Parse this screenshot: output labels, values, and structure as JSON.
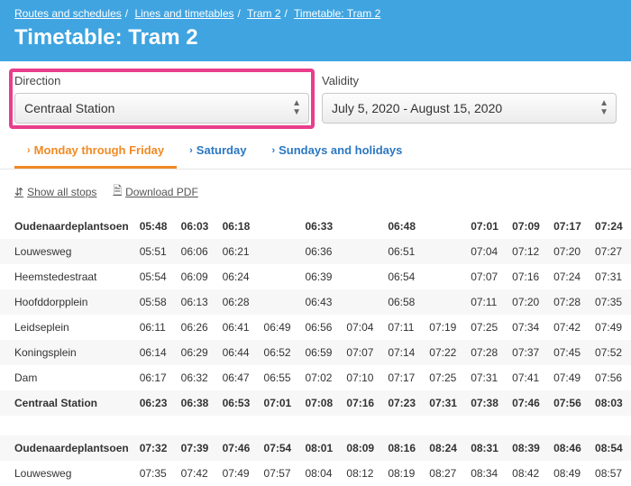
{
  "breadcrumb": [
    "Routes and schedules",
    "Lines and timetables",
    "Tram 2",
    "Timetable: Tram 2"
  ],
  "page_title": "Timetable: Tram 2",
  "selectors": {
    "direction_label": "Direction",
    "direction_value": "Centraal Station",
    "validity_label": "Validity",
    "validity_value": "July 5, 2020 - August 15, 2020"
  },
  "tabs": [
    "Monday through Friday",
    "Saturday",
    "Sundays and holidays"
  ],
  "actions": {
    "show_all_stops": "Show all stops",
    "download_pdf": "Download PDF"
  },
  "stops": [
    "Oudenaardeplantsoen",
    "Louwesweg",
    "Heemstedestraat",
    "Hoofddorpplein",
    "Leidseplein",
    "Koningsplein",
    "Dam",
    "Centraal Station"
  ],
  "block1": [
    [
      "05:48",
      "06:03",
      "06:18",
      "",
      "06:33",
      "",
      "06:48",
      "",
      "07:01",
      "07:09",
      "07:17",
      "07:24"
    ],
    [
      "05:51",
      "06:06",
      "06:21",
      "",
      "06:36",
      "",
      "06:51",
      "",
      "07:04",
      "07:12",
      "07:20",
      "07:27"
    ],
    [
      "05:54",
      "06:09",
      "06:24",
      "",
      "06:39",
      "",
      "06:54",
      "",
      "07:07",
      "07:16",
      "07:24",
      "07:31"
    ],
    [
      "05:58",
      "06:13",
      "06:28",
      "",
      "06:43",
      "",
      "06:58",
      "",
      "07:11",
      "07:20",
      "07:28",
      "07:35"
    ],
    [
      "06:11",
      "06:26",
      "06:41",
      "06:49",
      "06:56",
      "07:04",
      "07:11",
      "07:19",
      "07:25",
      "07:34",
      "07:42",
      "07:49"
    ],
    [
      "06:14",
      "06:29",
      "06:44",
      "06:52",
      "06:59",
      "07:07",
      "07:14",
      "07:22",
      "07:28",
      "07:37",
      "07:45",
      "07:52"
    ],
    [
      "06:17",
      "06:32",
      "06:47",
      "06:55",
      "07:02",
      "07:10",
      "07:17",
      "07:25",
      "07:31",
      "07:41",
      "07:49",
      "07:56"
    ],
    [
      "06:23",
      "06:38",
      "06:53",
      "07:01",
      "07:08",
      "07:16",
      "07:23",
      "07:31",
      "07:38",
      "07:46",
      "07:56",
      "08:03"
    ]
  ],
  "block2": [
    [
      "07:32",
      "07:39",
      "07:46",
      "07:54",
      "08:01",
      "08:09",
      "08:16",
      "08:24",
      "08:31",
      "08:39",
      "08:46",
      "08:54"
    ],
    [
      "07:35",
      "07:42",
      "07:49",
      "07:57",
      "08:04",
      "08:12",
      "08:19",
      "08:27",
      "08:34",
      "08:42",
      "08:49",
      "08:57"
    ]
  ]
}
